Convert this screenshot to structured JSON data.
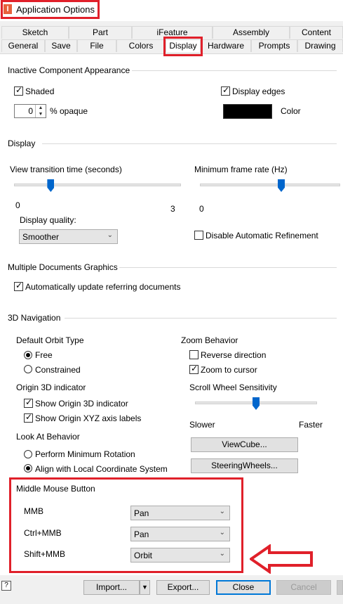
{
  "window": {
    "title": "Application Options",
    "icon": "app-icon"
  },
  "tabs": {
    "row1": [
      "Sketch",
      "Part",
      "iFeature",
      "Assembly",
      "Content"
    ],
    "row2": [
      "General",
      "Save",
      "File",
      "Colors",
      "Display",
      "Hardware",
      "Prompts",
      "Drawing"
    ],
    "active": "Display"
  },
  "inactive": {
    "heading": "Inactive Component Appearance",
    "shaded_label": "Shaded",
    "shaded_checked": true,
    "opacity_value": "0",
    "opacity_suffix": "% opaque",
    "display_edges_label": "Display edges",
    "display_edges_checked": true,
    "color_label": "Color",
    "color_swatch": "#000000"
  },
  "display": {
    "heading": "Display",
    "view_transition_label": "View transition time (seconds)",
    "view_transition_min": "0",
    "view_transition_max": "3",
    "view_transition_level": 0.22,
    "min_frame_rate_label": "Minimum frame rate (Hz)",
    "min_frame_rate_min": "0",
    "min_frame_rate_level": 0.58,
    "quality_label": "Display quality:",
    "quality_value": "Smoother",
    "disable_refinement_label": "Disable Automatic Refinement",
    "disable_refinement_checked": false
  },
  "multidoc": {
    "heading": "Multiple Documents Graphics",
    "auto_update_label": "Automatically update referring documents",
    "auto_update_checked": true
  },
  "nav": {
    "heading": "3D Navigation",
    "orbit_heading": "Default Orbit Type",
    "orbit_free": "Free",
    "orbit_constrained": "Constrained",
    "orbit_selected": "Free",
    "origin_heading": "Origin 3D indicator",
    "show_origin_label": "Show Origin 3D indicator",
    "show_axis_label": "Show Origin XYZ axis labels",
    "look_heading": "Look At Behavior",
    "look_min_rotation": "Perform Minimum Rotation",
    "look_align": "Align with Local Coordinate System",
    "look_selected": "Align with Local Coordinate System",
    "zoom_heading": "Zoom Behavior",
    "reverse_direction_label": "Reverse direction",
    "reverse_direction_checked": false,
    "zoom_cursor_label": "Zoom to cursor",
    "zoom_cursor_checked": true,
    "scroll_heading": "Scroll Wheel Sensitivity",
    "scroll_slower": "Slower",
    "scroll_faster": "Faster",
    "scroll_level": 0.5,
    "viewcube_button": "ViewCube...",
    "steeringwheels_button": "SteeringWheels..."
  },
  "mmb": {
    "heading": "Middle Mouse Button",
    "rows": [
      {
        "label": "MMB",
        "value": "Pan"
      },
      {
        "label": "Ctrl+MMB",
        "value": "Pan"
      },
      {
        "label": "Shift+MMB",
        "value": "Orbit"
      }
    ]
  },
  "footer": {
    "import_label": "Import...",
    "export_label": "Export...",
    "close_label": "Close",
    "cancel_label": "Cancel"
  },
  "colors": {
    "highlight": "#e0202a",
    "accent": "#0078d7",
    "slider_thumb": "#0066cc"
  }
}
